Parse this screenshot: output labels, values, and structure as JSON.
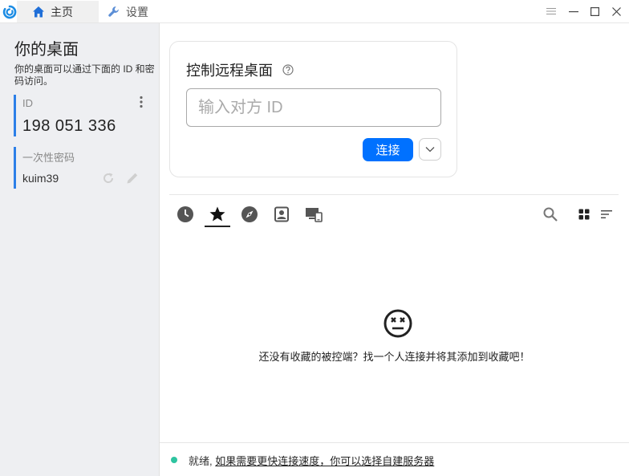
{
  "tabs": {
    "home": "主页",
    "settings": "设置"
  },
  "desktop": {
    "title": "你的桌面",
    "description": "你的桌面可以通过下面的 ID 和密码访问。",
    "id_label": "ID",
    "id_value": "198 051 336",
    "password_label": "一次性密码",
    "password_value": "kuim39"
  },
  "remote": {
    "title": "控制远程桌面",
    "input_placeholder": "输入对方 ID",
    "input_value": "",
    "connect_label": "连接"
  },
  "peers": {
    "tabs": [
      "recent-sessions",
      "favorites",
      "discovered",
      "address-book",
      "accessible-devices"
    ],
    "active_tab": "favorites",
    "empty_message": "还没有收藏的被控端？找一个人连接并将其添加到收藏吧！"
  },
  "status": {
    "state": "就绪,",
    "link": "如果需要更快连接速度，你可以选择自建服务器"
  },
  "colors": {
    "accent": "#0071ff",
    "id_bar": "#2c7fe8",
    "status_ok": "#2ec4a0"
  }
}
